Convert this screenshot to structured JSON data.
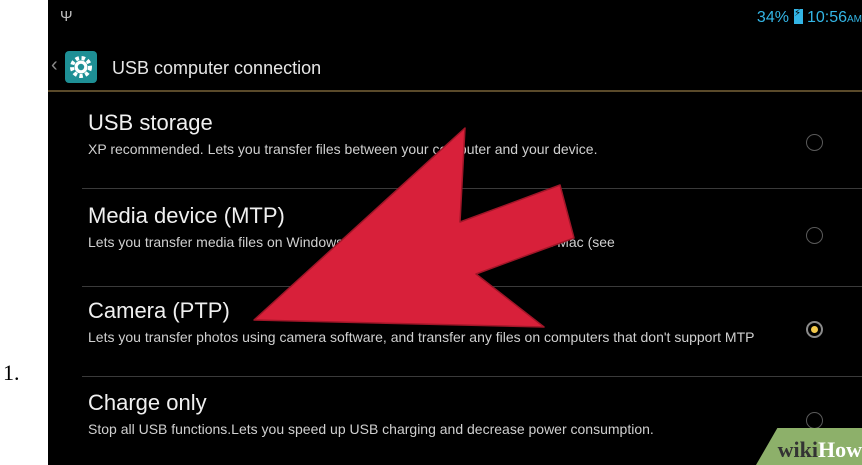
{
  "list_marker": "1.",
  "status_bar": {
    "usb_icon": "usb-icon",
    "battery": "34%",
    "battery_icon": "battery-charging-icon",
    "time": "10:56",
    "time_suffix": "AM",
    "accent_color": "#33b5e5"
  },
  "action_bar": {
    "back_icon": "back-chevron-icon",
    "settings_icon": "settings-gear-icon",
    "title": "USB computer connection"
  },
  "options": [
    {
      "title": "USB storage",
      "description": "XP recommended. Lets you transfer files between your computer and your device.",
      "selected": false
    },
    {
      "title": "Media device (MTP)",
      "description": "Lets you transfer media files on Windows, or using Android File Transfer on Mac (see",
      "selected": false
    },
    {
      "title": "Camera (PTP)",
      "description": "Lets you transfer photos using camera software, and transfer any files on computers that don't support MTP",
      "selected": true
    },
    {
      "title": "Charge only",
      "description": "Stop all USB functions.Lets you speed up USB charging and decrease power consumption.",
      "selected": false
    }
  ],
  "annotation": {
    "arrow_color": "#d8203a",
    "points_to": "Camera (PTP)"
  },
  "watermark": {
    "part1": "wiki",
    "part2": "How"
  }
}
